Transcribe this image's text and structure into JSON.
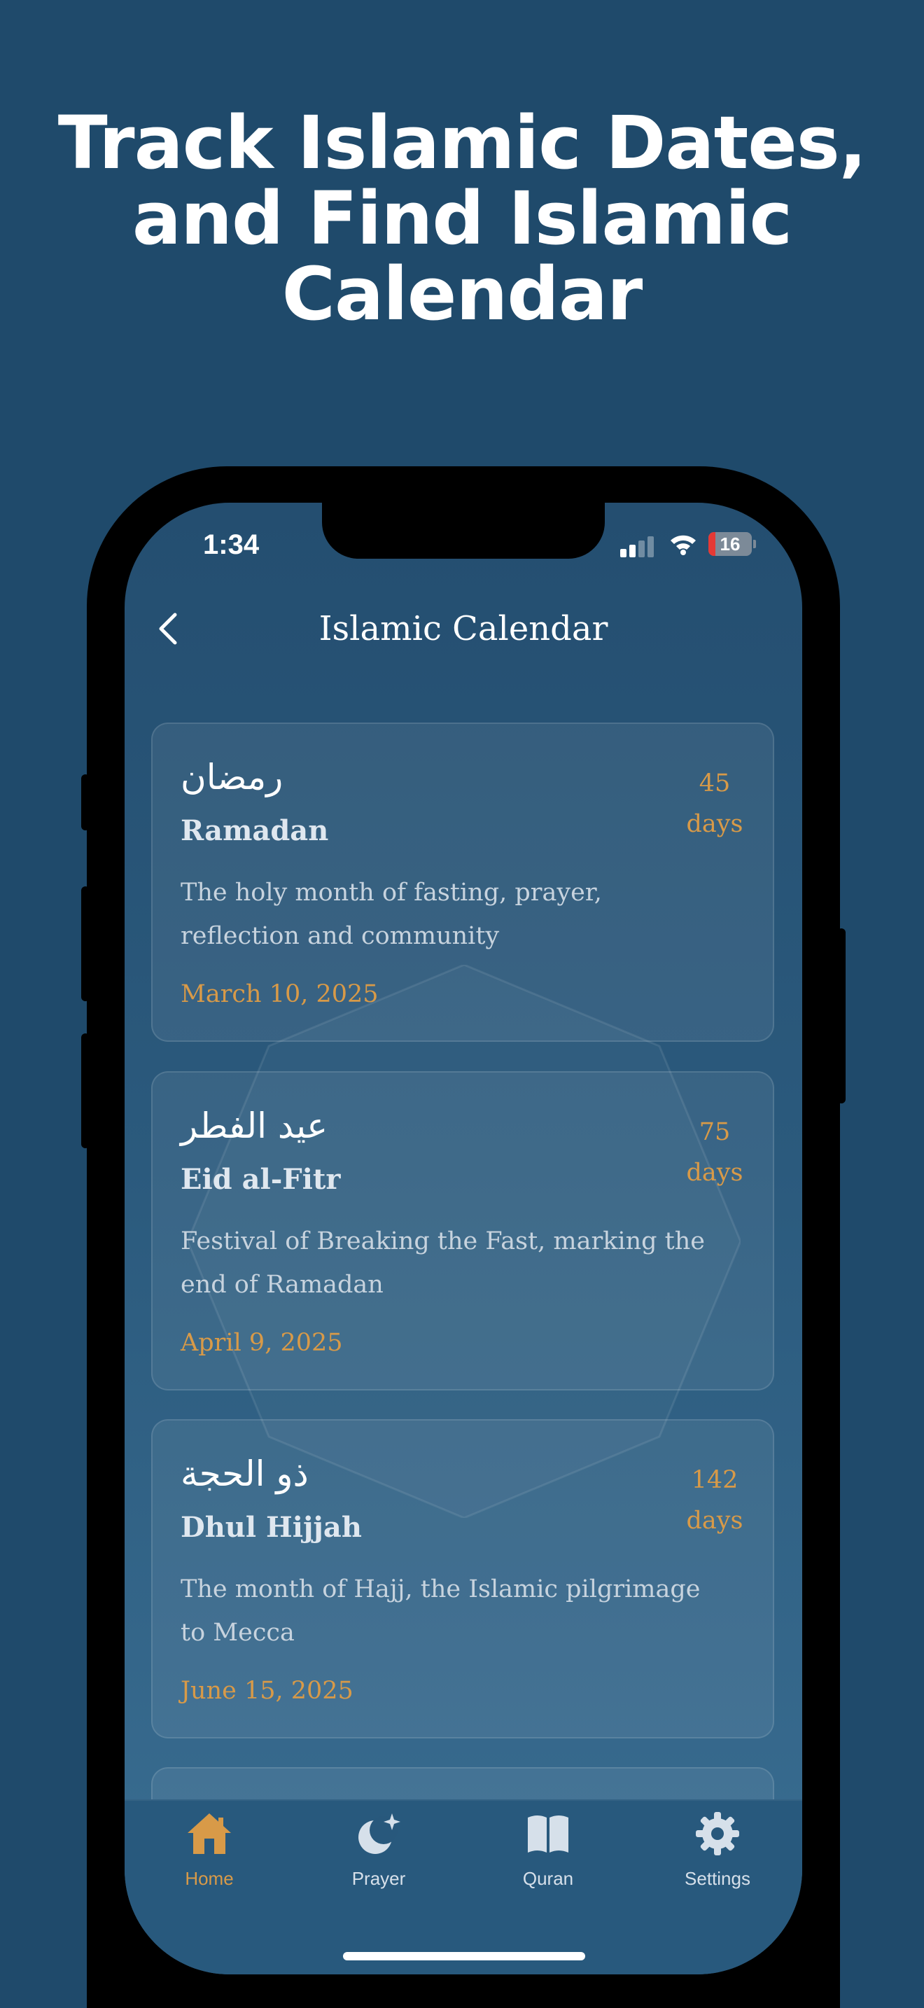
{
  "headline": {
    "line1": "Track Islamic Dates,",
    "line2": "and Find Islamic",
    "line3": "Calendar"
  },
  "status_bar": {
    "time": "1:34",
    "battery": "16",
    "battery_level": 0.16,
    "signal_bars_active": 2
  },
  "nav": {
    "title": "Islamic Calendar",
    "back_icon": "chevron-left-icon"
  },
  "events": [
    {
      "arabic": "رمضان",
      "name": "Ramadan",
      "description": "The holy month of fasting, prayer, reflection and community",
      "date": "March 10, 2025",
      "count": "45",
      "unit": "days"
    },
    {
      "arabic": "عيد الفطر",
      "name": "Eid al-Fitr",
      "description": "Festival of Breaking the Fast, marking the end of Ramadan",
      "date": "April 9, 2025",
      "count": "75",
      "unit": "days"
    },
    {
      "arabic": "ذو الحجة",
      "name": "Dhul Hijjah",
      "description": "The month of Hajj, the Islamic pilgrimage to Mecca",
      "date": "June 15, 2025",
      "count": "142",
      "unit": "days"
    }
  ],
  "tabbar": {
    "active": "Home",
    "tabs": [
      {
        "label": "Home",
        "icon": "home-icon"
      },
      {
        "label": "Prayer",
        "icon": "moon-star-icon"
      },
      {
        "label": "Quran",
        "icon": "book-icon"
      },
      {
        "label": "Settings",
        "icon": "gear-icon"
      }
    ]
  },
  "colors": {
    "background": "#1f4a6b",
    "accent": "#d89a48",
    "battery_low": "#e53935"
  }
}
